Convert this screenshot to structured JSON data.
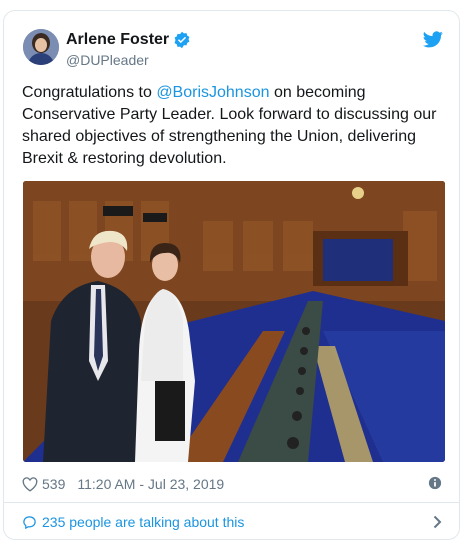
{
  "author": {
    "name": "Arlene Foster",
    "handle": "@DUPleader"
  },
  "tweet": {
    "text_before": "Congratulations to ",
    "mention": "@BorisJohnson",
    "text_after": " on becoming Conservative Party Leader. Look forward to discussing our shared objectives of strengthening the Union, delivering Brexit & restoring devolution."
  },
  "meta": {
    "likes": "539",
    "timestamp": "11:20 AM - Jul 23, 2019"
  },
  "conversation": {
    "label": "235 people are talking about this"
  },
  "icons": {
    "verified": "verified-badge-icon",
    "bird": "twitter-bird-icon",
    "heart": "heart-icon",
    "info": "info-icon",
    "bubble": "speech-bubble-icon",
    "chevron": "chevron-right-icon"
  },
  "colors": {
    "brand": "#1da1f2",
    "link": "#1b95e0",
    "muted": "#657786",
    "border": "#e1e8ed"
  }
}
